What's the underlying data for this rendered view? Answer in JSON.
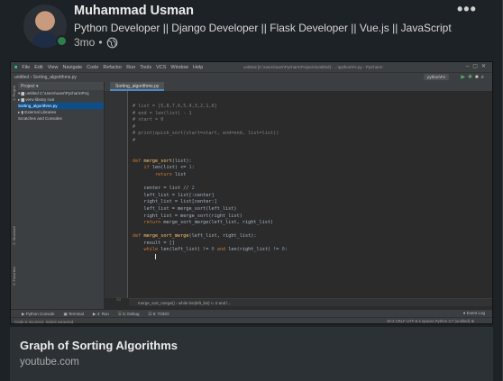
{
  "post": {
    "author_name": "Muhammad Usman",
    "headline": "Python Developer || Django Developer || Flask Developer || Vue.js || JavaScript",
    "time_ago": "3mo",
    "separator": "•",
    "visibility_icon": "globe-icon",
    "more_label": "•••"
  },
  "ide": {
    "menu": [
      "File",
      "Edit",
      "View",
      "Navigate",
      "Code",
      "Refactor",
      "Run",
      "Tools",
      "VCS",
      "Window",
      "Help"
    ],
    "title": "untitled [C:\\Users\\user\\PycharmProjects\\untitled] - ...\\python\\Fe.py - PyCharm",
    "nav_path": "untitled  ›  Sorting_algorithms.py",
    "run_config": "python\\Fe",
    "project_header": "Project ▾",
    "tree": [
      "▾ ▆ untitled  C:\\Users\\user\\PycharmProj",
      "   ▸ ▆ venv  library root",
      "      Sorting_algorithms.py",
      "▸ ▮ External Libraries",
      "   Scratches and Consoles"
    ],
    "tab_label": "Sorting_algorithms.py",
    "side_tools": [
      "1: Project",
      "2: Structure",
      "2: Favorites"
    ],
    "line_numbers": [
      "",
      "",
      "",
      "",
      "",
      "",
      "",
      "",
      "",
      "",
      "",
      "",
      "",
      "",
      "",
      "",
      "",
      "",
      "",
      "",
      "",
      "",
      "",
      "",
      "",
      "",
      "",
      "",
      "",
      "",
      "30"
    ],
    "breadcrumb": "merge_sort_merge()  ›  while len(left_list) != 0 and l...",
    "bottom_tools": [
      "▶ Python Console",
      "▣ Terminal",
      "▶ 4: Run",
      "☰ 5: Debug",
      "☑ 6: TODO"
    ],
    "event_log": "● Event Log",
    "status_left": "Code is incorrect. Indent expected.",
    "status_right": "49:3   CRLF   UTF-8   4 spaces   Python 3.7 (untitled)   ⊕"
  },
  "link": {
    "title": "Graph of Sorting Algorithms",
    "domain": "youtube.com"
  },
  "colors": {
    "card_bg": "#1d2226",
    "link_bg": "#2c3136",
    "presence": "#2e7d4f",
    "ide_selection": "#0d4f8b"
  }
}
